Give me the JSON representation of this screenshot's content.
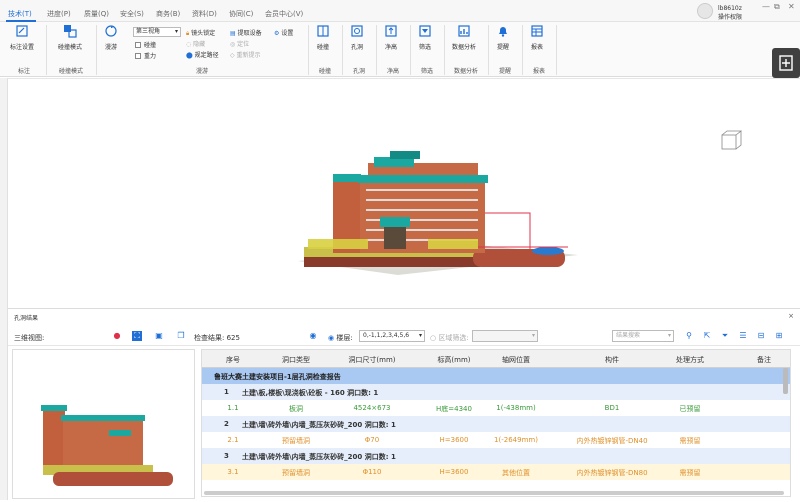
{
  "menu": {
    "tabs": [
      "技术(T)",
      "进度(P)",
      "质量(Q)",
      "安全(S)",
      "商务(B)",
      "资料(D)",
      "协同(C)",
      "会员中心(V)"
    ]
  },
  "user": {
    "name": "lb8610z",
    "sub": "操作权限"
  },
  "window": {
    "min": "—",
    "restore": "⧉",
    "close": "✕"
  },
  "ribbon": {
    "g1": {
      "btn": "标注设置",
      "label": "标注"
    },
    "g2": {
      "btn": "碰撞模式",
      "label": "碰撞模式"
    },
    "g3": {
      "big": "漫游",
      "view": "第三视角",
      "gravity": "碰撞",
      "gravity2": "重力",
      "lock": "镜头锁定",
      "hide": "隐藏",
      "path": "规定路径",
      "extract": "提取设备",
      "locate": "定位",
      "scene": "重新提示",
      "settings": "设置",
      "label": "漫游"
    },
    "g4": {
      "btn": "碰撞",
      "label": "碰撞"
    },
    "g5": {
      "btn": "孔洞",
      "label": "孔洞"
    },
    "g6": {
      "btn": "净高",
      "label": "净高"
    },
    "g7": {
      "btn": "筛选",
      "label": "筛选"
    },
    "g8": {
      "btn": "数据分析",
      "label": "数据分析"
    },
    "g9": {
      "btn": "提醒",
      "label": "提醒"
    },
    "g10": {
      "btn": "报表",
      "label": "报表"
    }
  },
  "panel": {
    "title": "孔洞结果",
    "close": "×",
    "view3d": "三维视图:",
    "count": "检查结果: 625",
    "floor_label": "楼层:",
    "floor_value": "0,-1,1,2,3,4,5,6",
    "region": "区域筛选:",
    "search_ph": "结果搜索"
  },
  "table": {
    "headers": [
      "序号",
      "洞口类型",
      "洞口尺寸(mm)",
      "标高(mm)",
      "轴网位置",
      "构件",
      "处理方式",
      "备注"
    ],
    "report": "鲁班大赛土建安装项目-1层孔洞检查报告",
    "groups": [
      {
        "no": "1",
        "title": "土建\\板,楼板\\现浇板\\砼板 - 160  洞口数: 1",
        "item": {
          "no": "1.1",
          "type": "板洞",
          "size": "4524×673",
          "elev": "H底=4340",
          "axis": "1(-438mm)",
          "comp": "BD1",
          "method": "已预留"
        }
      },
      {
        "no": "2",
        "title": "土建\\墙\\砖外墙\\内墙_蒸压灰砂砖_200  洞口数: 1",
        "item": {
          "no": "2.1",
          "type": "预留墙洞",
          "size": "Φ70",
          "elev": "H=3600",
          "axis": "1(-2649mm)",
          "comp": "内外热镀锌钢管-DN40",
          "method": "需预留"
        }
      },
      {
        "no": "3",
        "title": "土建\\墙\\砖外墙\\内墙_蒸压灰砂砖_200  洞口数: 1",
        "item": {
          "no": "3.1",
          "type": "预留墙洞",
          "size": "Φ110",
          "elev": "H=3600",
          "axis": "其他位置",
          "comp": "内外热镀锌钢管-DN80",
          "method": "需预留"
        }
      }
    ]
  },
  "colors": {
    "accent": "#1f6fd6",
    "report_bg": "#a9c8f2",
    "group_bg": "#e6eefb",
    "green": "#3a9a3a",
    "orange": "#e0912b"
  }
}
